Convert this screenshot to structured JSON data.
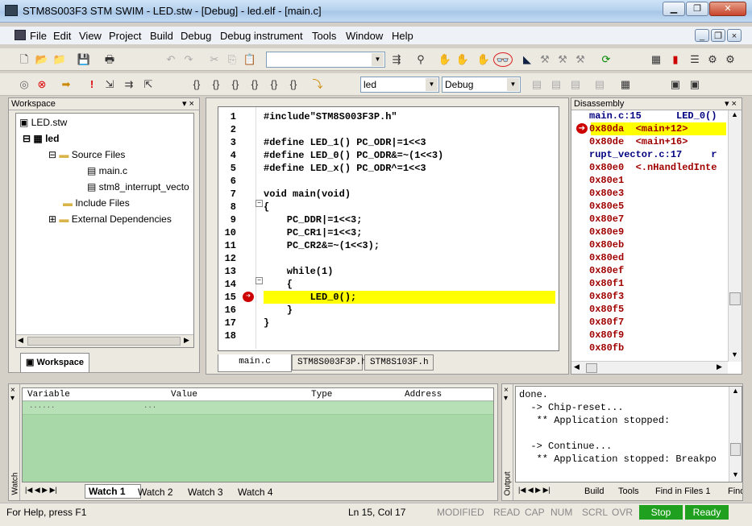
{
  "window": {
    "title": "STM8S003F3 STM SWIM - LED.stw - [Debug] - led.elf - [main.c]"
  },
  "menu": [
    "File",
    "Edit",
    "View",
    "Project",
    "Build",
    "Debug",
    "Debug instrument",
    "Tools",
    "Window",
    "Help"
  ],
  "toolbar2": {
    "project_combo": "led",
    "config_combo": "Debug"
  },
  "workspace": {
    "title": "Workspace",
    "tab_label": "Workspace",
    "root": "LED.stw",
    "project": "led",
    "folders": [
      "Source Files",
      "Include Files",
      "External Dependencies"
    ],
    "files": [
      "main.c",
      "stm8_interrupt_vecto"
    ]
  },
  "editor": {
    "lines": [
      {
        "n": "1",
        "t": "#include\"STM8S003F3P.h\""
      },
      {
        "n": "2",
        "t": ""
      },
      {
        "n": "3",
        "t": "#define LED_1() PC_ODR|=1<<3"
      },
      {
        "n": "4",
        "t": "#define LED_0() PC_ODR&=~(1<<3)"
      },
      {
        "n": "5",
        "t": "#define LED_x() PC_ODR^=1<<3"
      },
      {
        "n": "6",
        "t": ""
      },
      {
        "n": "7",
        "t": "void main(void)"
      },
      {
        "n": "8",
        "t": "{"
      },
      {
        "n": "9",
        "t": "    PC_DDR|=1<<3;"
      },
      {
        "n": "10",
        "t": "    PC_CR1|=1<<3;"
      },
      {
        "n": "11",
        "t": "    PC_CR2&=~(1<<3);"
      },
      {
        "n": "12",
        "t": ""
      },
      {
        "n": "13",
        "t": "    while(1)"
      },
      {
        "n": "14",
        "t": "    {"
      },
      {
        "n": "15",
        "t": "        LED_0();"
      },
      {
        "n": "16",
        "t": "    }"
      },
      {
        "n": "17",
        "t": "}"
      },
      {
        "n": "18",
        "t": ""
      }
    ],
    "tabs": [
      "main.c",
      "STM8S003F3P.h",
      "STM8S103F.h"
    ]
  },
  "disassembly": {
    "title": "Disassembly",
    "lines": [
      "main.c:15      LED_0()",
      "0x80da  <main+12>",
      "0x80de  <main+16>",
      "rupt_vector.c:17     r",
      "0x80e0  <.nHandledInte",
      "0x80e1",
      "0x80e3",
      "0x80e5",
      "0x80e7",
      "0x80e9",
      "0x80eb",
      "0x80ed",
      "0x80ef",
      "0x80f1",
      "0x80f3",
      "0x80f5",
      "0x80f7",
      "0x80f9",
      "0x80fb"
    ]
  },
  "watch": {
    "columns": [
      "Variable",
      "Value",
      "Type",
      "Address"
    ],
    "row_placeholder": "......",
    "row_value_placeholder": "...",
    "tabs": [
      "Watch 1",
      "Watch 2",
      "Watch 3",
      "Watch 4"
    ],
    "side_label": "Watch"
  },
  "output": {
    "lines": [
      "done.",
      "  -> Chip-reset...",
      "   ** Application stopped:",
      "",
      "  -> Continue...",
      "   ** Application stopped: Breakpo"
    ],
    "tabs": [
      "Build",
      "Tools",
      "Find in Files 1",
      "Find"
    ],
    "side_label": "Output"
  },
  "status": {
    "help": "For Help, press F1",
    "pos": "Ln 15, Col 17",
    "flags": [
      "MODIFIED",
      "READ",
      "CAP",
      "NUM",
      "SCRL",
      "OVR"
    ],
    "stop": "Stop",
    "ready": "Ready"
  },
  "colors": {
    "exec_highlight": "#ffff00",
    "status_green": "#1fa01f"
  }
}
